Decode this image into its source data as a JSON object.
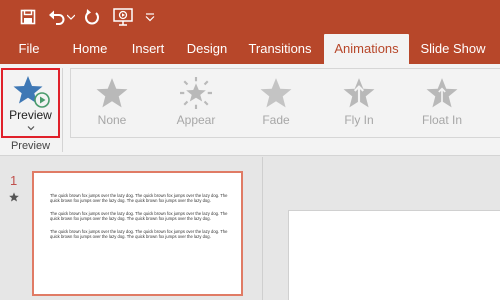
{
  "colors": {
    "accent": "#b7472a",
    "ribbon": "#f3f3f3",
    "highlight_border": "#e0202a",
    "disabled": "#a7a7a7"
  },
  "quick_access": [
    {
      "name": "save-icon"
    },
    {
      "name": "undo-icon"
    },
    {
      "name": "undo-dropdown-icon"
    },
    {
      "name": "redo-icon"
    },
    {
      "name": "start-from-beginning-icon"
    },
    {
      "name": "customize-quick-access-icon"
    }
  ],
  "tabs": [
    {
      "label": "File"
    },
    {
      "label": "Home"
    },
    {
      "label": "Insert"
    },
    {
      "label": "Design"
    },
    {
      "label": "Transitions"
    },
    {
      "label": "Animations",
      "active": true
    },
    {
      "label": "Slide Show"
    }
  ],
  "ribbon": {
    "preview_group": {
      "button_label": "Preview",
      "group_label": "Preview"
    },
    "animations": [
      {
        "label": "None",
        "icon": "star-icon"
      },
      {
        "label": "Appear",
        "icon": "burst-star-icon"
      },
      {
        "label": "Fade",
        "icon": "star-icon"
      },
      {
        "label": "Fly In",
        "icon": "fly-in-star-icon"
      },
      {
        "label": "Float In",
        "icon": "float-in-star-icon"
      }
    ]
  },
  "slides": [
    {
      "number": "1",
      "paragraphs": [
        "The quick brown fox jumps over the lazy dog. The quick brown fox jumps over the lazy dog. The quick brown fox jumps over the lazy dog. The quick brown fox jumps over the lazy dog.",
        "The quick brown fox jumps over the lazy dog. The quick brown fox jumps over the lazy dog. The quick brown fox jumps over the lazy dog. The quick brown fox jumps over the lazy dog.",
        "The quick brown fox jumps over the lazy dog. The quick brown fox jumps over the lazy dog. The quick brown fox jumps over the lazy dog. The quick brown fox jumps over the lazy dog."
      ]
    }
  ]
}
